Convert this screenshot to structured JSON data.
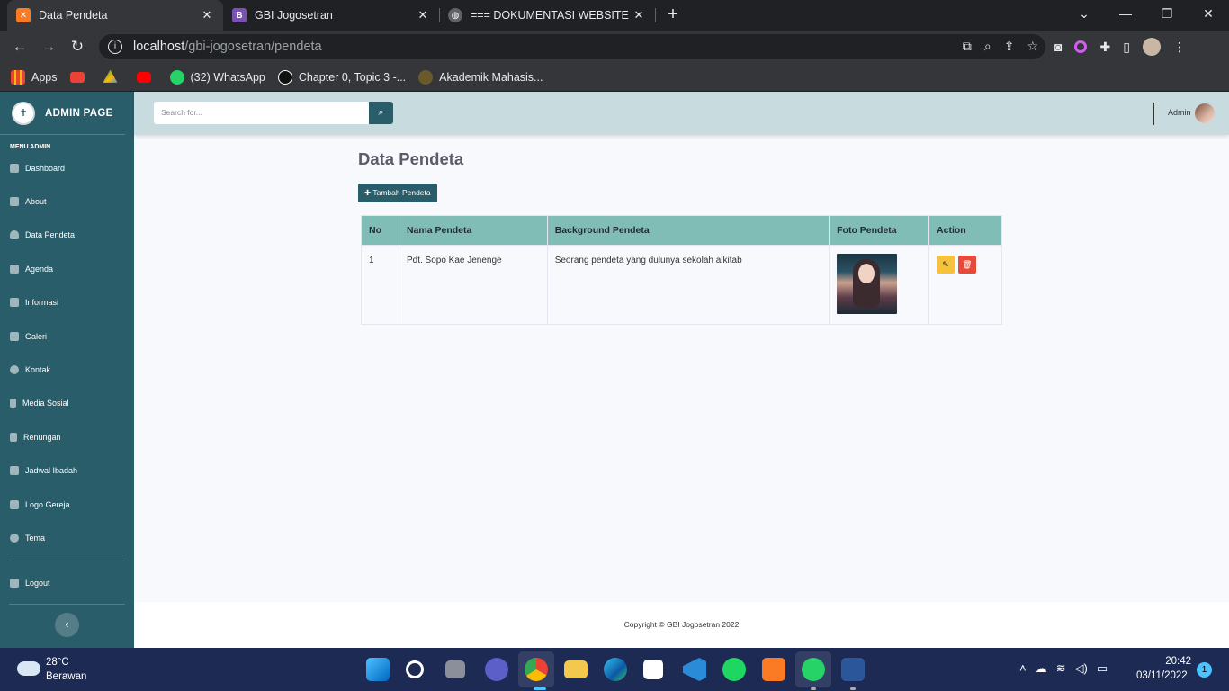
{
  "browser": {
    "tabs": [
      {
        "title": "Data Pendeta",
        "icon": "xampp-icon",
        "active": true
      },
      {
        "title": "GBI Jogosetran",
        "icon": "bootstrap-icon",
        "active": false
      },
      {
        "title": "=== DOKUMENTASI WEBSITE SI",
        "icon": "globe-icon",
        "active": false
      }
    ],
    "url_host": "localhost",
    "url_path": "/gbi-jogosetran/pendeta",
    "bookmarks": [
      {
        "label": "Apps",
        "icon": "apps-grid-icon"
      },
      {
        "label": "",
        "icon": "gmail-icon"
      },
      {
        "label": "",
        "icon": "drive-icon"
      },
      {
        "label": "",
        "icon": "youtube-icon"
      },
      {
        "label": "(32) WhatsApp",
        "icon": "whatsapp-icon"
      },
      {
        "label": "Chapter 0, Topic 3 -...",
        "icon": "circle-icon"
      },
      {
        "label": "Akademik Mahasis...",
        "icon": "university-icon"
      }
    ]
  },
  "sidebar": {
    "brand": "ADMIN PAGE",
    "heading": "MENU ADMIN",
    "items": [
      {
        "label": "Dashboard",
        "icon": "palette-icon"
      },
      {
        "label": "About",
        "icon": "sitemap-icon"
      },
      {
        "label": "Data Pendeta",
        "icon": "user-icon"
      },
      {
        "label": "Agenda",
        "icon": "copy-icon"
      },
      {
        "label": "Informasi",
        "icon": "book-icon"
      },
      {
        "label": "Galeri",
        "icon": "image-icon"
      },
      {
        "label": "Kontak",
        "icon": "phone-icon"
      },
      {
        "label": "Media Sosial",
        "icon": "mobile-icon"
      },
      {
        "label": "Renungan",
        "icon": "bookmark-icon"
      },
      {
        "label": "Jadwal Ibadah",
        "icon": "calendar-icon"
      },
      {
        "label": "Logo Gereja",
        "icon": "crown-icon"
      },
      {
        "label": "Tema",
        "icon": "paint-icon"
      }
    ],
    "logout": "Logout",
    "toggle_icon": "chevron-left-icon"
  },
  "topbar": {
    "search_placeholder": "Search for...",
    "user_name": "Admin"
  },
  "main": {
    "title": "Data Pendeta",
    "add_button": "Tambah Pendeta",
    "columns": [
      "No",
      "Nama Pendeta",
      "Background Pendeta",
      "Foto Pendeta",
      "Action"
    ],
    "rows": [
      {
        "no": "1",
        "nama": "Pdt. Sopo Kae Jenenge",
        "background": "Seorang pendeta yang dulunya sekolah alkitab"
      }
    ]
  },
  "footer": {
    "copyright": "Copyright © GBI Jogosetran 2022"
  },
  "taskbar": {
    "temp": "28°C",
    "weather": "Berawan",
    "time": "20:42",
    "date": "03/11/2022",
    "notifications": "1"
  },
  "colors": {
    "sidebar": "#2a5d6a",
    "topbar": "#c8dbdf",
    "table_header": "#80bdb7",
    "edit": "#f6c23e",
    "delete": "#e74a3b"
  }
}
